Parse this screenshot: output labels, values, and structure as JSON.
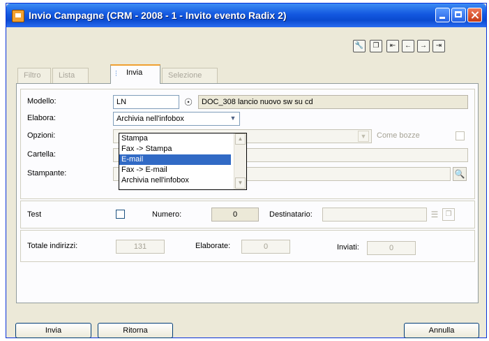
{
  "window": {
    "title": "Invio Campagne (CRM - 2008 - 1 - Invito evento Radix 2)"
  },
  "toolbar": {
    "icons": [
      "wrench-icon",
      "export-icon",
      "first-record-icon",
      "previous-record-icon",
      "next-record-icon",
      "last-record-icon"
    ]
  },
  "tabs": [
    "Filtro",
    "Lista",
    "Invia",
    "Selezione"
  ],
  "form": {
    "modello_label": "Modello:",
    "modello_code": "LN",
    "modello_description": "DOC_308 lancio nuovo sw su cd",
    "elabora_label": "Elabora:",
    "elabora_value": "Archivia nell'infobox",
    "elabora_options": [
      "Stampa",
      "Fax -> Stampa",
      "E-mail",
      "Fax -> E-mail",
      "Archivia nell'infobox"
    ],
    "elabora_highlighted": "E-mail",
    "opzioni_label": "Opzioni:",
    "come_bozze_label": "Come bozze",
    "cartella_label": "Cartella:",
    "stampante_label": "Stampante:"
  },
  "test": {
    "label": "Test",
    "numero_label": "Numero:",
    "numero_value": "0",
    "destinatario_label": "Destinatario:"
  },
  "totals": {
    "totale_label": "Totale indirizzi:",
    "totale_value": "131",
    "elaborate_label": "Elaborate:",
    "elaborate_value": "0",
    "inviati_label": "Inviati:",
    "inviati_value": "0"
  },
  "buttons": {
    "invia": "Invia",
    "ritorna": "Ritorna",
    "annulla": "Annulla"
  }
}
